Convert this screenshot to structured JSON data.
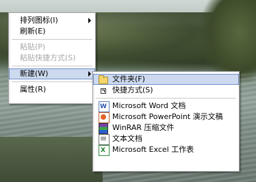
{
  "context_menu": {
    "items": [
      {
        "label": "排列图标(I)",
        "submenu": true,
        "enabled": true
      },
      {
        "label": "刷新(E)",
        "enabled": true
      },
      {
        "label": "粘贴(P)",
        "enabled": false
      },
      {
        "label": "粘贴快捷方式(S)",
        "enabled": false
      },
      {
        "label": "新建(W)",
        "submenu": true,
        "enabled": true,
        "highlighted": true
      },
      {
        "label": "属性(R)",
        "enabled": true
      }
    ]
  },
  "new_submenu": {
    "items": [
      {
        "label": "文件夹(F)",
        "icon": "folder-icon",
        "highlighted": true
      },
      {
        "label": "快捷方式(S)",
        "icon": "shortcut-icon"
      },
      {
        "label": "Microsoft Word 文档",
        "icon": "word-document-icon"
      },
      {
        "label": "Microsoft PowerPoint 演示文稿",
        "icon": "powerpoint-icon"
      },
      {
        "label": "WinRAR 压缩文件",
        "icon": "winrar-archive-icon"
      },
      {
        "label": "文本文档",
        "icon": "text-document-icon"
      },
      {
        "label": "Microsoft Excel 工作表",
        "icon": "excel-icon"
      }
    ]
  },
  "colors": {
    "highlight_fill": "#ccd9ee",
    "highlight_border": "#6f8fc9",
    "disabled_text": "#a7a7a7"
  }
}
